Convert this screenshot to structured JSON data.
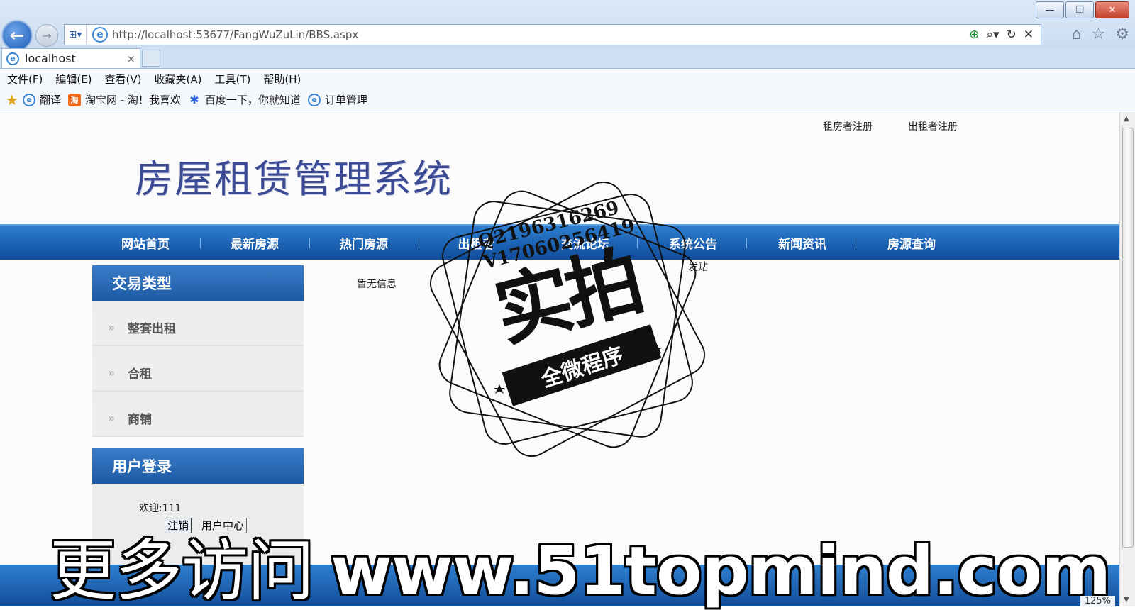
{
  "browser": {
    "url": "http://localhost:53677/FangWuZuLin/BBS.aspx",
    "tab_title": "localhost",
    "tab_close": "×",
    "menu": [
      "文件(F)",
      "编辑(E)",
      "查看(V)",
      "收藏夹(A)",
      "工具(T)",
      "帮助(H)"
    ],
    "favorites": [
      "翻译",
      "淘宝网 - 淘！我喜欢",
      "百度一下，你就知道",
      "订单管理"
    ],
    "zoom": "125%"
  },
  "header": {
    "register_tenant": "租房者注册",
    "register_landlord": "出租者注册",
    "site_title": "房屋租赁管理系统"
  },
  "nav": [
    "网站首页",
    "最新房源",
    "热门房源",
    "出租者",
    "交流论坛",
    "系统公告",
    "新闻资讯",
    "房源查询"
  ],
  "sidebar": {
    "trade_title": "交易类型",
    "trade_items": [
      "整套出租",
      "合租",
      "商铺"
    ],
    "login_title": "用户登录",
    "welcome": "欢迎:111",
    "logout": "注销",
    "user_center": "用户中心"
  },
  "main": {
    "no_info": "暂无信息",
    "post": "发贴"
  },
  "overlay": {
    "stamp_qq": "Q2196316269",
    "stamp_v": "V17060256419",
    "stamp_main": "实拍",
    "stamp_ribbon": "全微程序",
    "banner_cn": "更多访问",
    "banner_url": "www.51topmind.com"
  }
}
